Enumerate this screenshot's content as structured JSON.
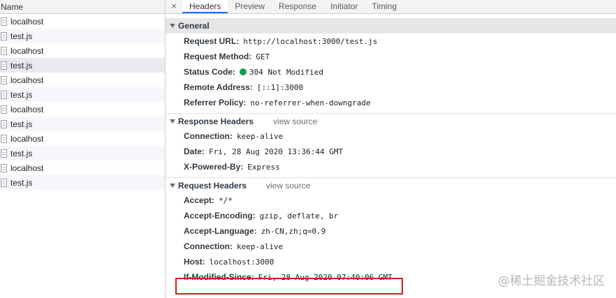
{
  "list": {
    "header": "Name",
    "items": [
      {
        "name": "localhost"
      },
      {
        "name": "test.js"
      },
      {
        "name": "localhost"
      },
      {
        "name": "test.js"
      },
      {
        "name": "localhost"
      },
      {
        "name": "test.js"
      },
      {
        "name": "localhost"
      },
      {
        "name": "test.js"
      },
      {
        "name": "localhost"
      },
      {
        "name": "test.js"
      },
      {
        "name": "localhost"
      },
      {
        "name": "test.js"
      }
    ]
  },
  "tabs": {
    "close": "×",
    "items": [
      "Headers",
      "Preview",
      "Response",
      "Initiator",
      "Timing"
    ],
    "active": "Headers"
  },
  "general": {
    "title": "General",
    "rows": [
      {
        "name": "Request URL:",
        "value": "http://localhost:3000/test.js"
      },
      {
        "name": "Request Method:",
        "value": "GET"
      },
      {
        "name": "Status Code:",
        "value": "304 Not Modified"
      },
      {
        "name": "Remote Address:",
        "value": "[::1]:3000"
      },
      {
        "name": "Referrer Policy:",
        "value": "no-referrer-when-downgrade"
      }
    ]
  },
  "response_headers": {
    "title": "Response Headers",
    "view_source": "view source",
    "rows": [
      {
        "name": "Connection:",
        "value": "keep-alive"
      },
      {
        "name": "Date:",
        "value": "Fri, 28 Aug 2020 13:36:44 GMT"
      },
      {
        "name": "X-Powered-By:",
        "value": "Express"
      }
    ]
  },
  "request_headers": {
    "title": "Request Headers",
    "view_source": "view source",
    "rows": [
      {
        "name": "Accept:",
        "value": "*/*"
      },
      {
        "name": "Accept-Encoding:",
        "value": "gzip, deflate, br"
      },
      {
        "name": "Accept-Language:",
        "value": "zh-CN,zh;q=0.9"
      },
      {
        "name": "Connection:",
        "value": "keep-alive"
      },
      {
        "name": "Host:",
        "value": "localhost:3000"
      },
      {
        "name": "If-Modified-Since:",
        "value": "Fri, 28 Aug 2020 07:40:06 GMT"
      }
    ]
  },
  "colors": {
    "status_ok": "#0f9d58",
    "highlight": "#d91a1a",
    "active_tab": "#1a73e8"
  },
  "watermark": "@稀土掘金技术社区"
}
